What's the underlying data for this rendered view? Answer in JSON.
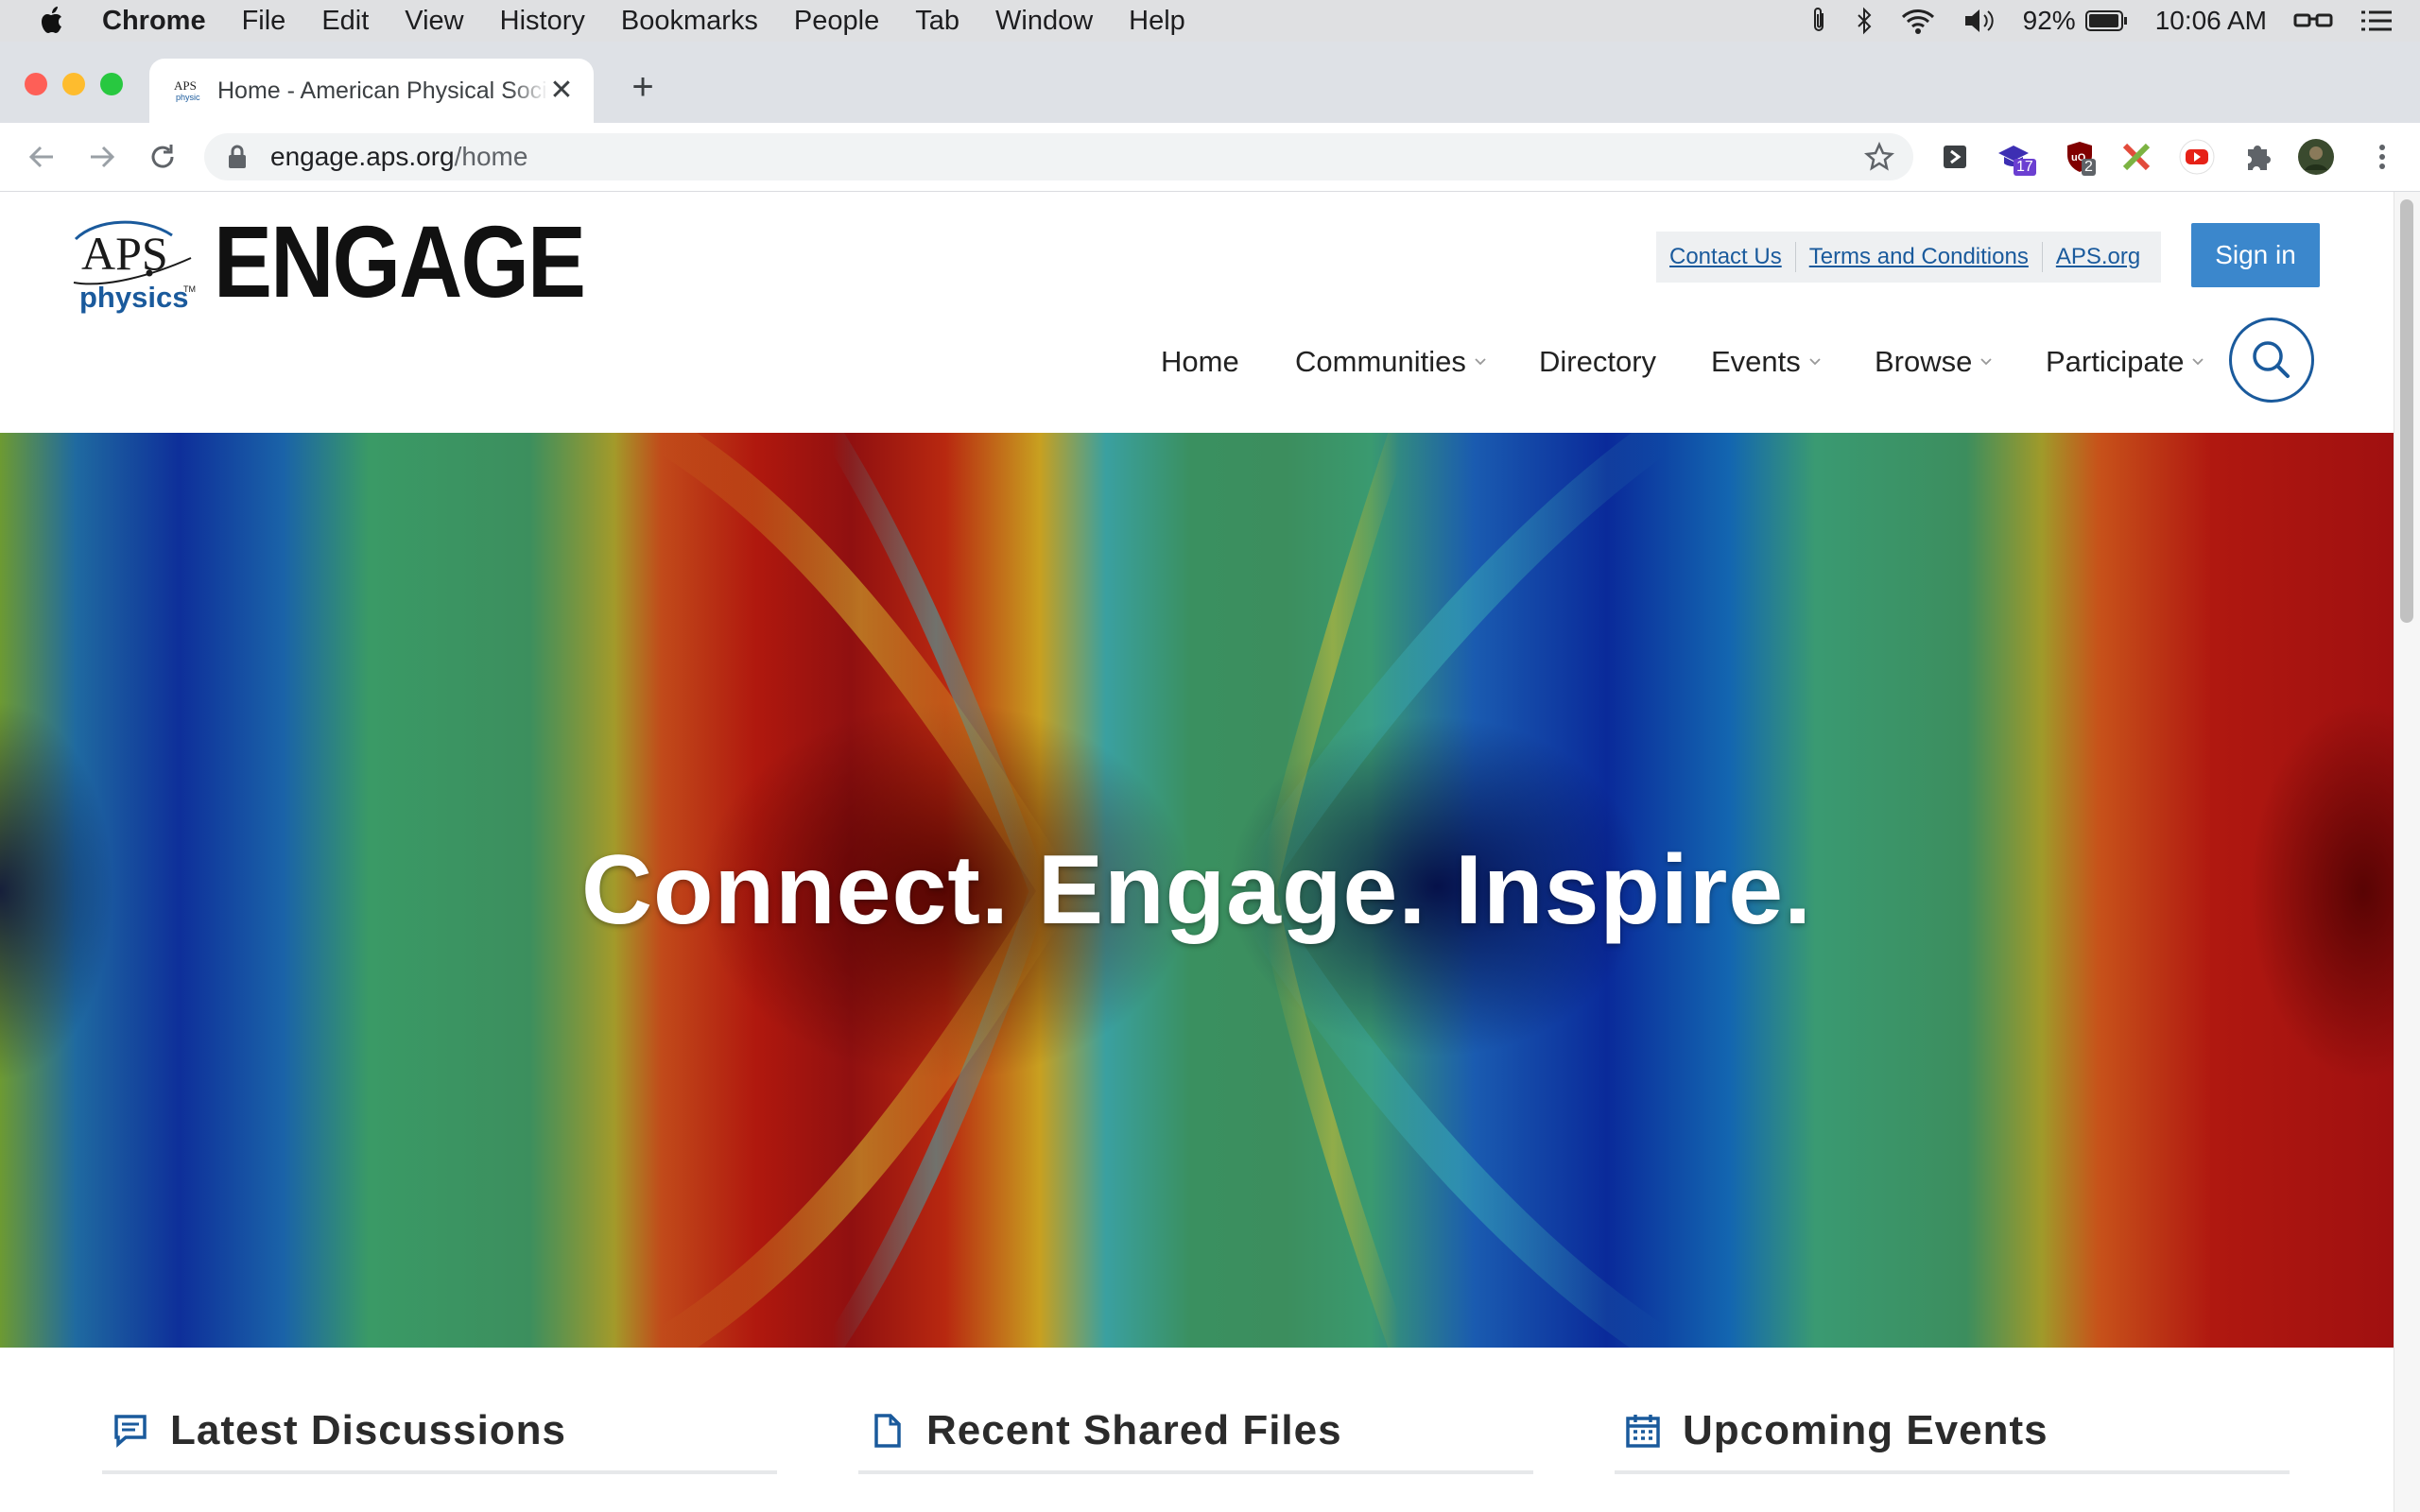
{
  "menubar": {
    "app_name": "Chrome",
    "items": [
      "File",
      "Edit",
      "View",
      "History",
      "Bookmarks",
      "People",
      "Tab",
      "Window",
      "Help"
    ],
    "battery": "92%",
    "clock": "10:06 AM"
  },
  "browser": {
    "tab_title": "Home - American Physical Society",
    "url_host": "engage.aps.org",
    "url_path": "/home",
    "ext_badge_1": "17",
    "ext_badge_2": "2"
  },
  "site": {
    "logo_aps": "APS",
    "logo_physics": "physics",
    "logo_tm": "TM",
    "brand": "ENGAGE",
    "utility_links": [
      "Contact Us",
      "Terms and Conditions",
      "APS.org"
    ],
    "sign_in": "Sign in",
    "nav": [
      "Home",
      "Communities",
      "Directory",
      "Events",
      "Browse",
      "Participate"
    ]
  },
  "hero": {
    "title": "Connect. Engage. Inspire."
  },
  "sections": [
    "Latest Discussions",
    "Recent Shared Files",
    "Upcoming Events"
  ],
  "colors": {
    "accent_blue": "#1a5a9c",
    "signin_blue": "#3b87cc"
  }
}
